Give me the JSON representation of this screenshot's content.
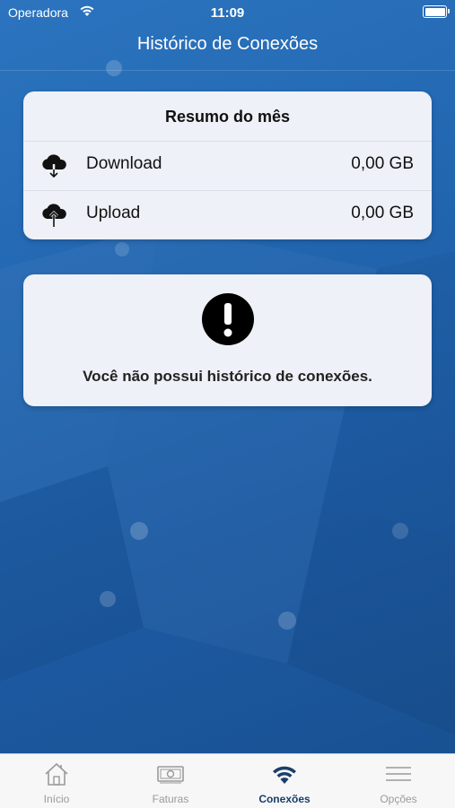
{
  "status_bar": {
    "carrier": "Operadora",
    "time": "11:09"
  },
  "nav": {
    "title": "Histórico de Conexões"
  },
  "summary": {
    "title": "Resumo do mês",
    "rows": [
      {
        "icon": "cloud-download-icon",
        "label": "Download",
        "value": "0,00 GB"
      },
      {
        "icon": "cloud-upload-icon",
        "label": "Upload",
        "value": "0,00 GB"
      }
    ]
  },
  "empty_state": {
    "icon": "exclamation-icon",
    "message": "Você não possui histórico de conexões."
  },
  "tabbar": {
    "tabs": [
      {
        "label": "Início",
        "icon": "home-icon",
        "active": false
      },
      {
        "label": "Faturas",
        "icon": "banknote-icon",
        "active": false
      },
      {
        "label": "Conexões",
        "icon": "wifi-icon",
        "active": true
      },
      {
        "label": "Opções",
        "icon": "menu-icon",
        "active": false
      }
    ]
  },
  "colors": {
    "background": "#2266b0",
    "card": "#eef1f7",
    "active_tab": "#1a3e6b",
    "inactive_tab": "#9a9a9a"
  }
}
